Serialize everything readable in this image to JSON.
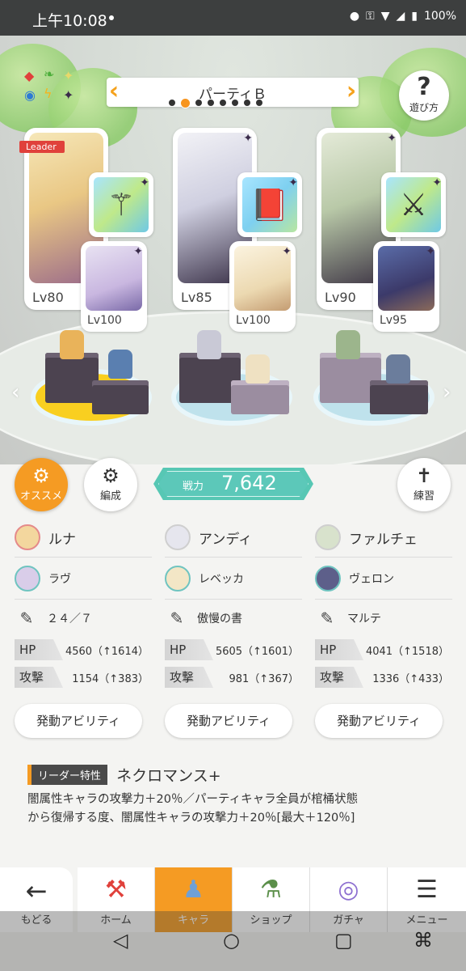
{
  "status": {
    "time": "上午10:08",
    "battery": "100%"
  },
  "party": {
    "name": "パーティＢ",
    "page_count": 8,
    "active_index": 1
  },
  "help": {
    "label": "遊び方"
  },
  "members": [
    {
      "leader_tag": "Leader",
      "main_lv": "Lv80",
      "sub_lv": "Lv100",
      "weapon_icon": "wand-icon"
    },
    {
      "leader_tag": "",
      "main_lv": "Lv85",
      "sub_lv": "Lv100",
      "weapon_icon": "book-icon"
    },
    {
      "leader_tag": "",
      "main_lv": "Lv90",
      "sub_lv": "Lv95",
      "weapon_icon": "spear-icon"
    }
  ],
  "buttons": {
    "recommend": "オススメ",
    "formation": "編成",
    "practice": "練習"
  },
  "power": {
    "label": "戦力",
    "value": "7,642"
  },
  "details": [
    {
      "main_name": "ルナ",
      "sub_name": "ラヴ",
      "weapon": "２４／７",
      "hp_label": "HP",
      "hp": "4560（↑1614）",
      "atk_label": "攻撃",
      "atk": "1154（↑383）",
      "ability": "発動アビリティ"
    },
    {
      "main_name": "アンディ",
      "sub_name": "レベッカ",
      "weapon": "傲慢の書",
      "hp_label": "HP",
      "hp": "5605（↑1601）",
      "atk_label": "攻撃",
      "atk": "981（↑367）",
      "ability": "発動アビリティ"
    },
    {
      "main_name": "ファルチェ",
      "sub_name": "ヴェロン",
      "weapon": "マルテ",
      "hp_label": "HP",
      "hp": "4041（↑1518）",
      "atk_label": "攻撃",
      "atk": "1336（↑433）",
      "ability": "発動アビリティ"
    }
  ],
  "leader_skill": {
    "label": "リーダー特性",
    "name": "ネクロマンス+",
    "line1": "闇属性キャラの攻撃力＋20％／パーティキャラ全員が棺桶状態",
    "line2": "から復帰する度、闇属性キャラの攻撃力＋20％[最大＋120％]"
  },
  "nav": {
    "back": "もどる",
    "home": "ホーム",
    "chara": "キャラ",
    "shop": "ショップ",
    "gacha": "ガチャ",
    "menu": "メニュー"
  },
  "colors": {
    "accent": "#f59b23",
    "power": "#57c7b4",
    "leader_tag": "#e0413b"
  }
}
